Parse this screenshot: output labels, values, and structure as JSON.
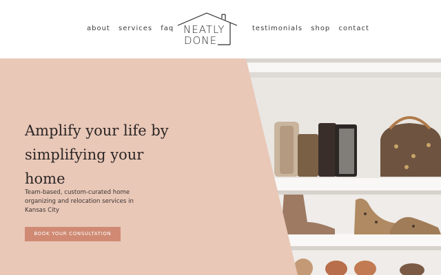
{
  "nav": {
    "left": [
      {
        "label": "about"
      },
      {
        "label": "services"
      },
      {
        "label": "faq"
      }
    ],
    "right": [
      {
        "label": "testimonials"
      },
      {
        "label": "shop"
      },
      {
        "label": "contact"
      }
    ]
  },
  "logo": {
    "line1": "NEATLY",
    "line2": "DONE"
  },
  "hero": {
    "headline": "Amplify your life by simplifying your home",
    "subtext": "Team-based, custom-curated home organizing and relocation services in Kansas City",
    "cta_label": "BOOK YOUR CONSULTATION",
    "image_subject": "shoe-and-handbag-closet-shelves"
  },
  "colors": {
    "panel": "#e9c8b8",
    "cta": "#d08a73",
    "text": "#2b2524",
    "header_bg": "#ffffff"
  }
}
